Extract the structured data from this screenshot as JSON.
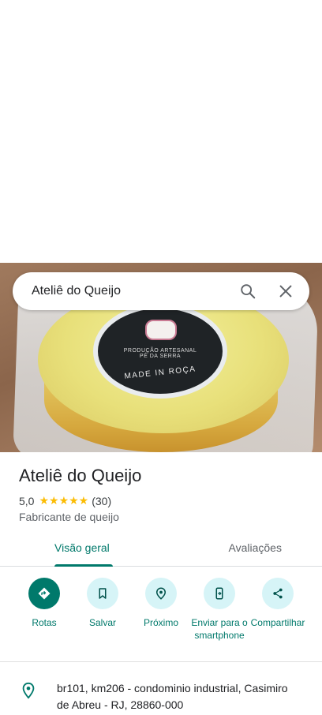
{
  "search": {
    "query": "Ateliê do Queijo"
  },
  "photo": {
    "label_line1": "PRODUÇÃO ARTESANAL",
    "label_line2": "PÉ DA SERRA",
    "label_line3": "MADE IN ROÇA"
  },
  "place": {
    "name": "Ateliê do Queijo",
    "rating": "5,0",
    "stars": "★★★★★",
    "review_count": "(30)",
    "category": "Fabricante de queijo"
  },
  "tabs": [
    {
      "label": "Visão geral",
      "active": true
    },
    {
      "label": "Avaliações",
      "active": false
    }
  ],
  "actions": [
    {
      "label": "Rotas",
      "icon": "directions-icon"
    },
    {
      "label": "Salvar",
      "icon": "bookmark-icon"
    },
    {
      "label": "Próximo",
      "icon": "nearby-icon"
    },
    {
      "label": "Enviar para o smartphone",
      "icon": "send-to-phone-icon"
    },
    {
      "label": "Compartilhar",
      "icon": "share-icon"
    }
  ],
  "address": {
    "text": "br101, km206 - condominio industrial, Casimiro de Abreu - RJ, 28860-000"
  },
  "colors": {
    "accent": "#00796b",
    "action_bg": "#d6f4f7",
    "star": "#fbbc04"
  }
}
